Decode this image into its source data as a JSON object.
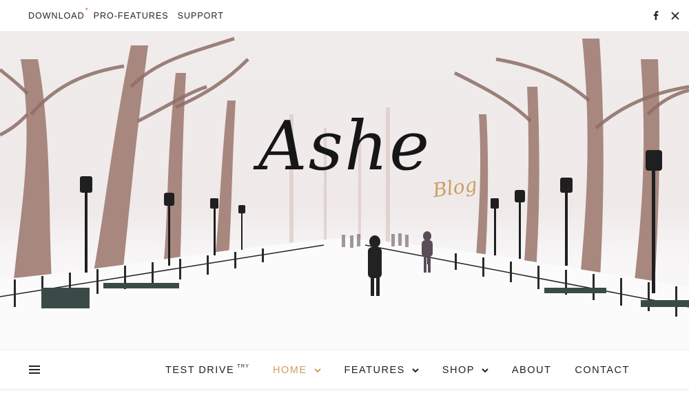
{
  "topbar": {
    "links": [
      "DOWNLOAD",
      "PRO-FEATURES",
      "SUPPORT"
    ],
    "download_star": "*",
    "social": [
      "facebook-icon",
      "x-twitter-icon"
    ]
  },
  "hero": {
    "logo_title": "Ashe",
    "logo_subtitle": "Blog"
  },
  "nav": {
    "menu_icon": "hamburger-icon",
    "items": [
      {
        "label": "TEST DRIVE",
        "superscript": "TRY"
      },
      {
        "label": "HOME",
        "active": true,
        "dropdown": true
      },
      {
        "label": "FEATURES",
        "dropdown": true
      },
      {
        "label": "SHOP",
        "dropdown": true
      },
      {
        "label": "ABOUT"
      },
      {
        "label": "CONTACT"
      }
    ]
  },
  "colors": {
    "accent": "#c9a063",
    "text": "#222222",
    "star": "#e23b3b"
  }
}
